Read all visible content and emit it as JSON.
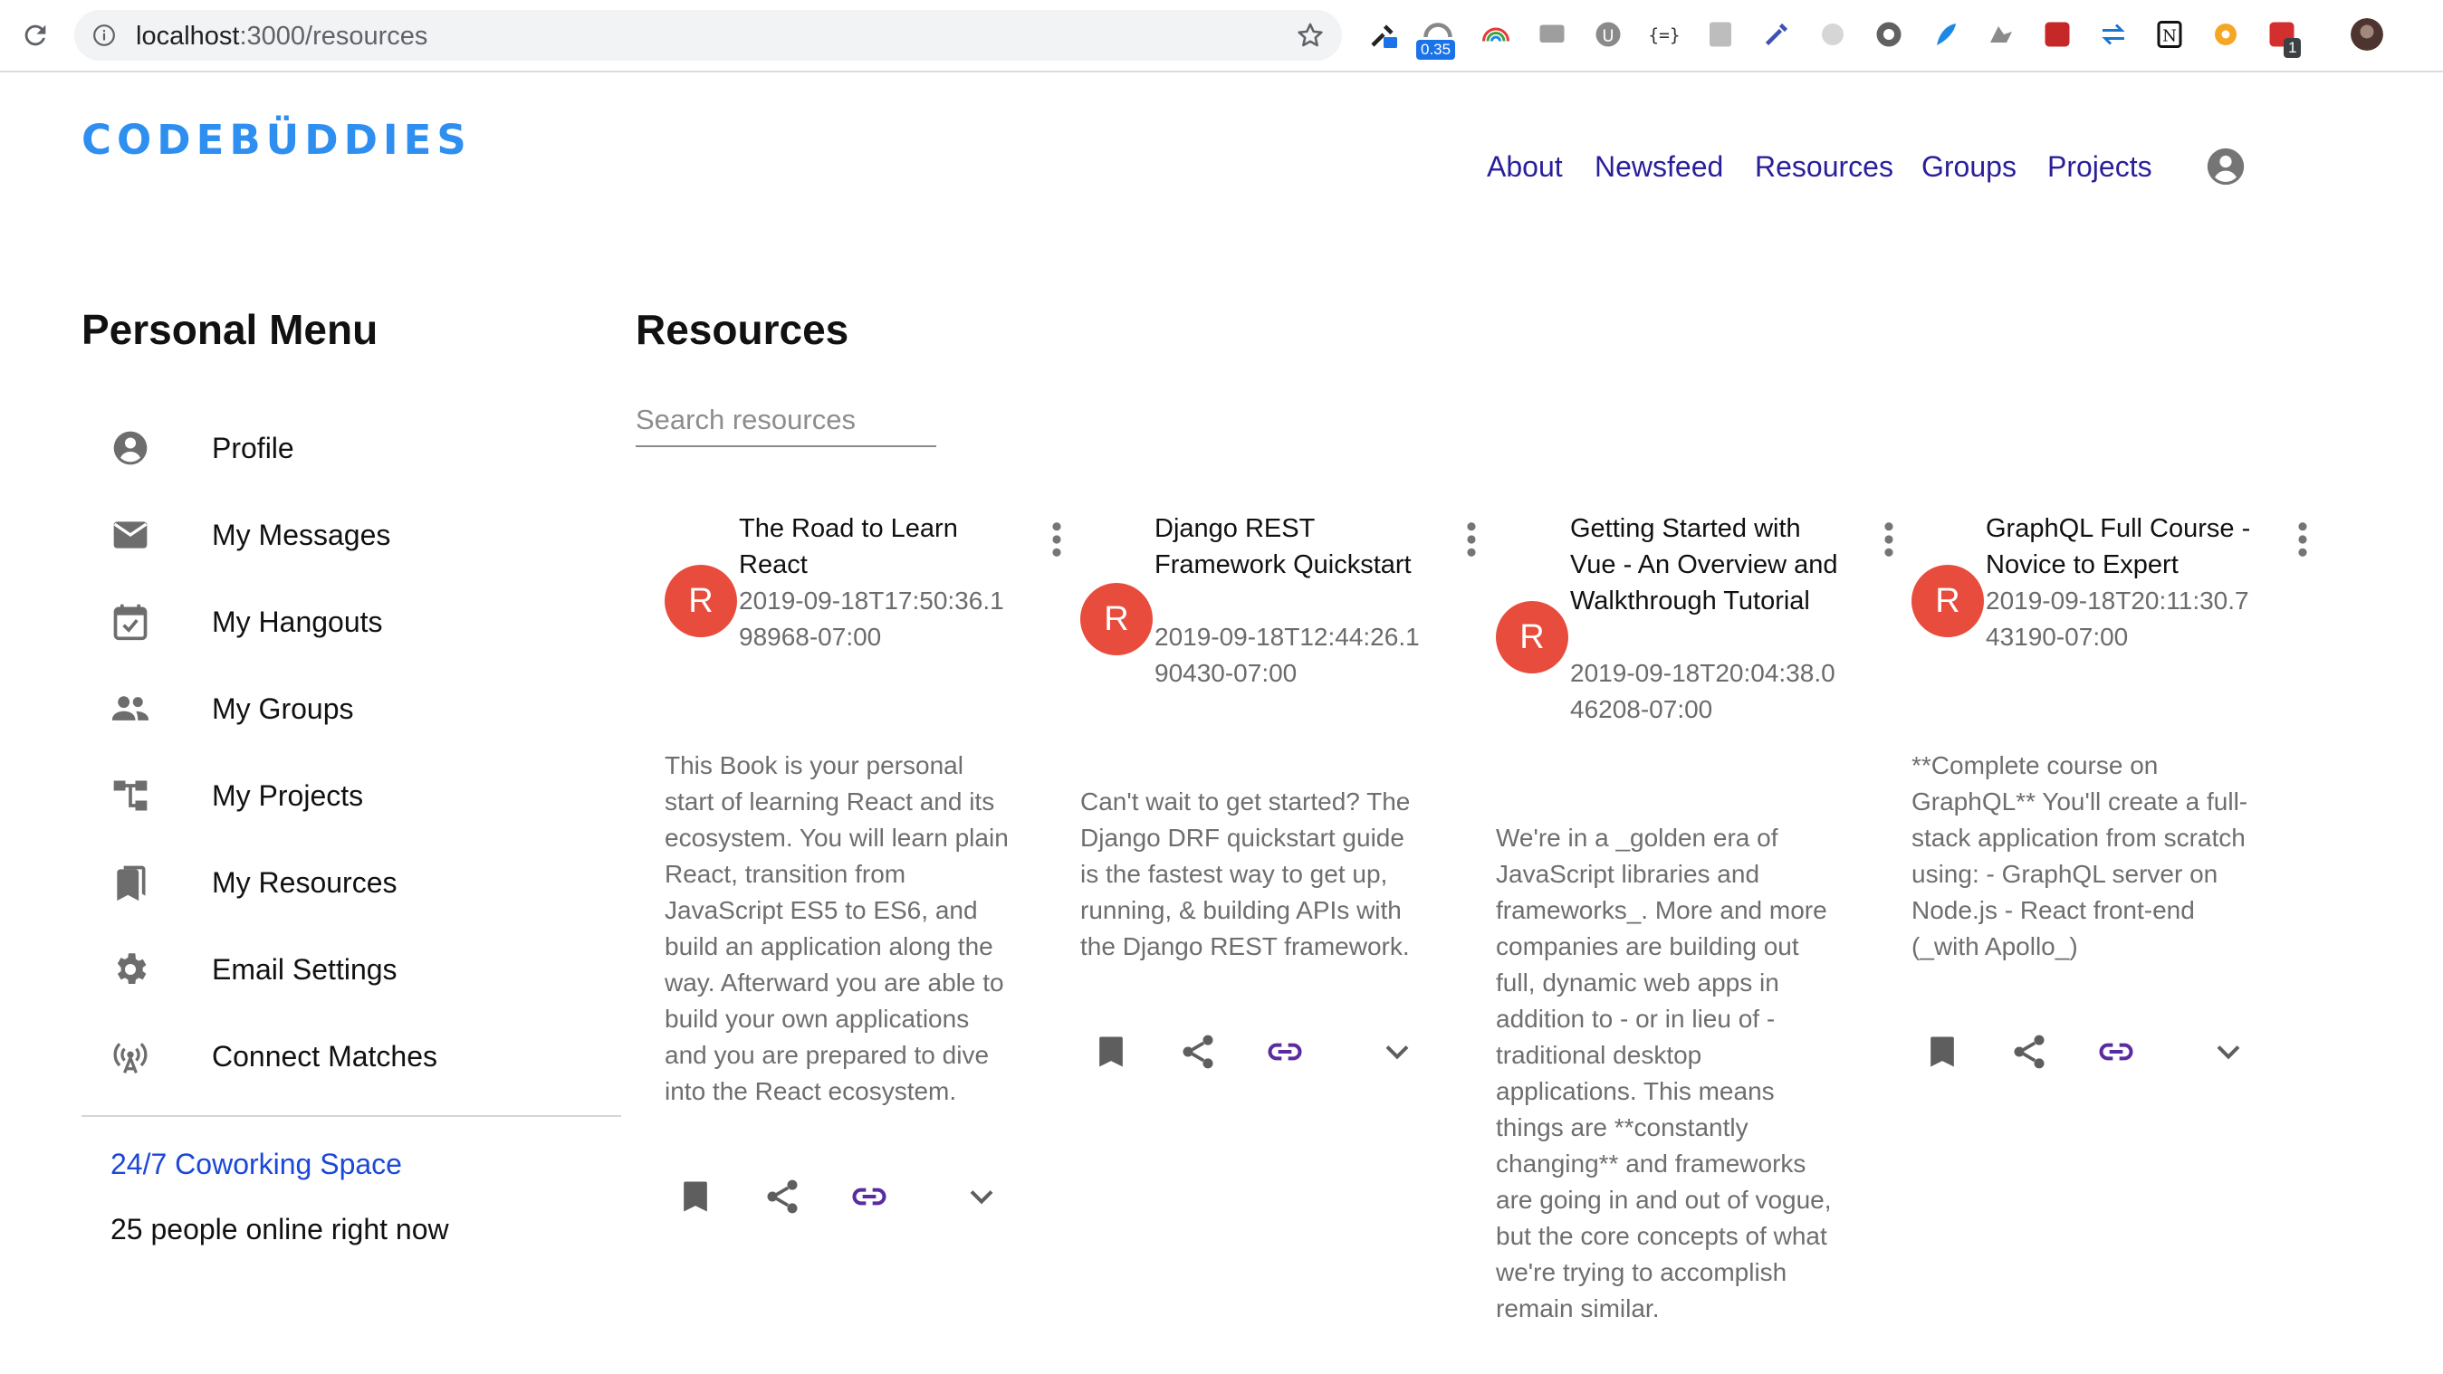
{
  "browser": {
    "url_host": "localhost",
    "url_path": ":3000/resources",
    "ext_badge_speed": "0.35",
    "ext_badge_count": "1"
  },
  "site": {
    "logo": "CODEBÜDDIES",
    "nav": [
      "About",
      "Newsfeed",
      "Resources",
      "Groups",
      "Projects"
    ],
    "brand_color": "#2f8ff0",
    "nav_color": "#2a1f9b"
  },
  "sidebar": {
    "title": "Personal Menu",
    "items": [
      {
        "label": "Profile",
        "icon": "account-circle-icon"
      },
      {
        "label": "My Messages",
        "icon": "mail-icon"
      },
      {
        "label": "My Hangouts",
        "icon": "calendar-check-icon"
      },
      {
        "label": "My Groups",
        "icon": "people-icon"
      },
      {
        "label": "My Projects",
        "icon": "project-tree-icon"
      },
      {
        "label": "My Resources",
        "icon": "bookmarks-icon"
      },
      {
        "label": "Email Settings",
        "icon": "gear-icon"
      },
      {
        "label": "Connect Matches",
        "icon": "broadcast-antenna-icon"
      }
    ],
    "cowork_link": "24/7 Coworking Space",
    "online_text": "25 people online right now"
  },
  "main": {
    "title": "Resources",
    "search_placeholder": "Search resources",
    "cards": [
      {
        "avatar": "R",
        "title": "The Road to Learn React",
        "date": "2019-09-18T17:50:36.198968-07:00",
        "description": "This Book is your personal start of learning React and its ecosystem. You will learn plain React, transition from JavaScript ES5 to ES6, and build an application along the way. Afterward you are able to build your own applications and you are prepared to dive into the React ecosystem."
      },
      {
        "avatar": "R",
        "title": "Django REST Framework Quickstart",
        "date": "2019-09-18T12:44:26.190430-07:00",
        "description": "Can't wait to get started? The Django DRF quickstart guide is the fastest way to get up, running, & building APIs with the Django REST framework."
      },
      {
        "avatar": "R",
        "title": "Getting Started with Vue - An Overview and Walkthrough Tutorial",
        "date": "2019-09-18T20:04:38.046208-07:00",
        "description": "We're in a _golden era of JavaScript libraries and frameworks_. More and more companies are building out full, dynamic web apps in addition to - or in lieu of - traditional desktop applications. This means things are **constantly changing** and frameworks are going in and out of vogue, but the core concepts of what we're trying to accomplish remain similar."
      },
      {
        "avatar": "R",
        "title": "GraphQL Full Course - Novice to Expert",
        "date": "2019-09-18T20:11:30.743190-07:00",
        "description": "**Complete course on GraphQL** You'll create a full-stack application from scratch using: - GraphQL server on Node.js - React front-end (_with Apollo_)"
      }
    ],
    "avatar_color": "#e74c3c",
    "link_icon_color": "#5b2ca0"
  }
}
